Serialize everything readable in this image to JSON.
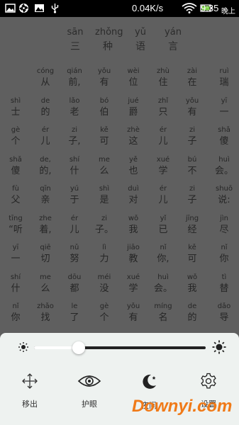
{
  "status_bar": {
    "speed": "0.04K/s",
    "time": "9:35",
    "period": "晚上"
  },
  "title": [
    {
      "py": "sān",
      "hz": "三"
    },
    {
      "py": "zhǒng",
      "hz": "种"
    },
    {
      "py": "yǔ",
      "hz": "语"
    },
    {
      "py": "yán",
      "hz": "言"
    }
  ],
  "poem_rows": [
    [
      {
        "py": "",
        "hz": ""
      },
      {
        "py": "cóng",
        "hz": "从"
      },
      {
        "py": "qián",
        "hz": "前,"
      },
      {
        "py": "yǒu",
        "hz": "有"
      },
      {
        "py": "wèi",
        "hz": "位"
      },
      {
        "py": "zhù",
        "hz": "住"
      },
      {
        "py": "zài",
        "hz": "在"
      },
      {
        "py": "ruì",
        "hz": "瑞"
      }
    ],
    [
      {
        "py": "shì",
        "hz": "士"
      },
      {
        "py": "de",
        "hz": "的"
      },
      {
        "py": "lǎo",
        "hz": "老"
      },
      {
        "py": "bó",
        "hz": "伯"
      },
      {
        "py": "jué",
        "hz": "爵"
      },
      {
        "py": "zhǐ",
        "hz": "只"
      },
      {
        "py": "yǒu",
        "hz": "有"
      },
      {
        "py": "yī",
        "hz": "一"
      }
    ],
    [
      {
        "py": "gè",
        "hz": "个"
      },
      {
        "py": "ér",
        "hz": "儿"
      },
      {
        "py": "zi",
        "hz": "子,"
      },
      {
        "py": "kě",
        "hz": "可"
      },
      {
        "py": "zhè",
        "hz": "这"
      },
      {
        "py": "ér",
        "hz": "儿"
      },
      {
        "py": "zi",
        "hz": "子"
      },
      {
        "py": "shǎ",
        "hz": "傻"
      }
    ],
    [
      {
        "py": "shǎ",
        "hz": "傻"
      },
      {
        "py": "de,",
        "hz": "的,"
      },
      {
        "py": "shí",
        "hz": "什"
      },
      {
        "py": "me",
        "hz": "么"
      },
      {
        "py": "yě",
        "hz": "也"
      },
      {
        "py": "xué",
        "hz": "学"
      },
      {
        "py": "bú",
        "hz": "不"
      },
      {
        "py": "huì",
        "hz": "会。"
      }
    ],
    [
      {
        "py": "fù",
        "hz": "父"
      },
      {
        "py": "qīn",
        "hz": "亲"
      },
      {
        "py": "yú",
        "hz": "于"
      },
      {
        "py": "shì",
        "hz": "是"
      },
      {
        "py": "duì",
        "hz": "对"
      },
      {
        "py": "ér",
        "hz": "儿"
      },
      {
        "py": "zi",
        "hz": "子"
      },
      {
        "py": "shuō",
        "hz": "说:"
      }
    ],
    [
      {
        "py": "tīng",
        "hz": "“听"
      },
      {
        "py": "zhe",
        "hz": "着,"
      },
      {
        "py": "ér",
        "hz": "儿"
      },
      {
        "py": "zi",
        "hz": "子。"
      },
      {
        "py": "wǒ",
        "hz": "我"
      },
      {
        "py": "yǐ",
        "hz": "已"
      },
      {
        "py": "jīng",
        "hz": "经"
      },
      {
        "py": "jìn",
        "hz": "尽"
      }
    ],
    [
      {
        "py": "yī",
        "hz": "一"
      },
      {
        "py": "qiē",
        "hz": "切"
      },
      {
        "py": "nǔ",
        "hz": "努"
      },
      {
        "py": "lì",
        "hz": "力"
      },
      {
        "py": "jiāo",
        "hz": "教"
      },
      {
        "py": "nǐ",
        "hz": "你,"
      },
      {
        "py": "kě",
        "hz": "可"
      },
      {
        "py": "nǐ",
        "hz": "你"
      }
    ],
    [
      {
        "py": "shí",
        "hz": "什"
      },
      {
        "py": "me",
        "hz": "么"
      },
      {
        "py": "dōu",
        "hz": "都"
      },
      {
        "py": "méi",
        "hz": "没"
      },
      {
        "py": "xué",
        "hz": "学"
      },
      {
        "py": "huì",
        "hz": "会。"
      },
      {
        "py": "wǒ",
        "hz": "我"
      },
      {
        "py": "tì",
        "hz": "替"
      }
    ],
    [
      {
        "py": "nǐ",
        "hz": "你"
      },
      {
        "py": "zhǎo",
        "hz": "找"
      },
      {
        "py": "le",
        "hz": "了"
      },
      {
        "py": "gè",
        "hz": "个"
      },
      {
        "py": "yǒu",
        "hz": "有"
      },
      {
        "py": "míng",
        "hz": "名"
      },
      {
        "py": "de",
        "hz": "的"
      },
      {
        "py": "dǎo",
        "hz": "导"
      }
    ]
  ],
  "brightness": {
    "level": 0.26
  },
  "actions": [
    {
      "label": "移出",
      "icon": "move-icon"
    },
    {
      "label": "护眼",
      "icon": "eye-icon"
    },
    {
      "label": "夜间",
      "icon": "moon-icon"
    },
    {
      "label": "设置",
      "icon": "gear-icon"
    }
  ],
  "watermark": "Downyi.com"
}
